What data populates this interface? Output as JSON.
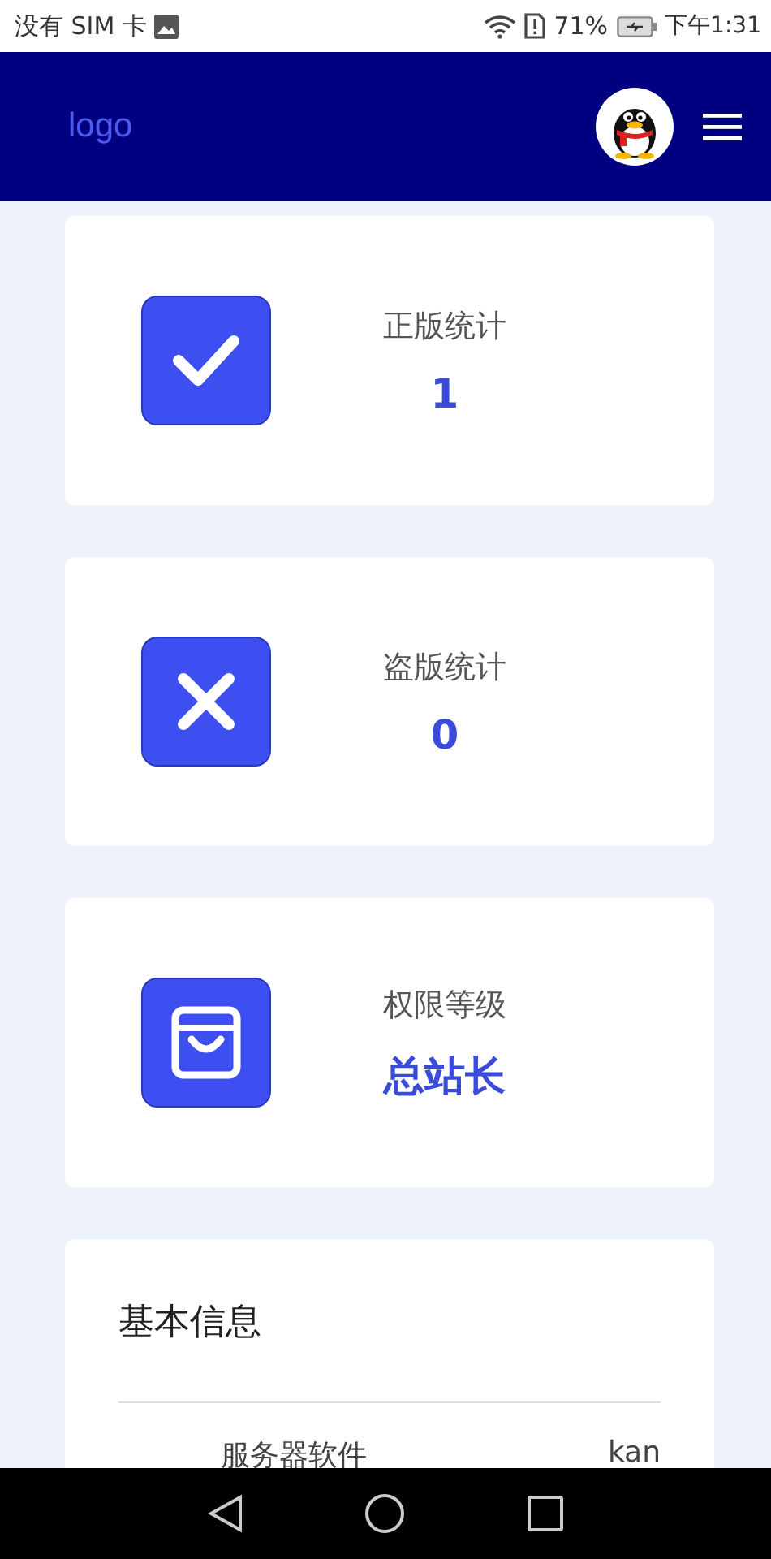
{
  "status_bar": {
    "carrier": "没有 SIM 卡",
    "battery": "71%",
    "time": "下午1:31"
  },
  "header": {
    "logo": "logo"
  },
  "stats": [
    {
      "kind": "check",
      "label": "正版统计",
      "value": "1"
    },
    {
      "kind": "cross",
      "label": "盗版统计",
      "value": "0"
    },
    {
      "kind": "bag",
      "label": "权限等级",
      "value": "总站长"
    }
  ],
  "info": {
    "title": "基本信息",
    "rows": [
      {
        "label": "服务器软件",
        "value": "kan"
      }
    ]
  }
}
